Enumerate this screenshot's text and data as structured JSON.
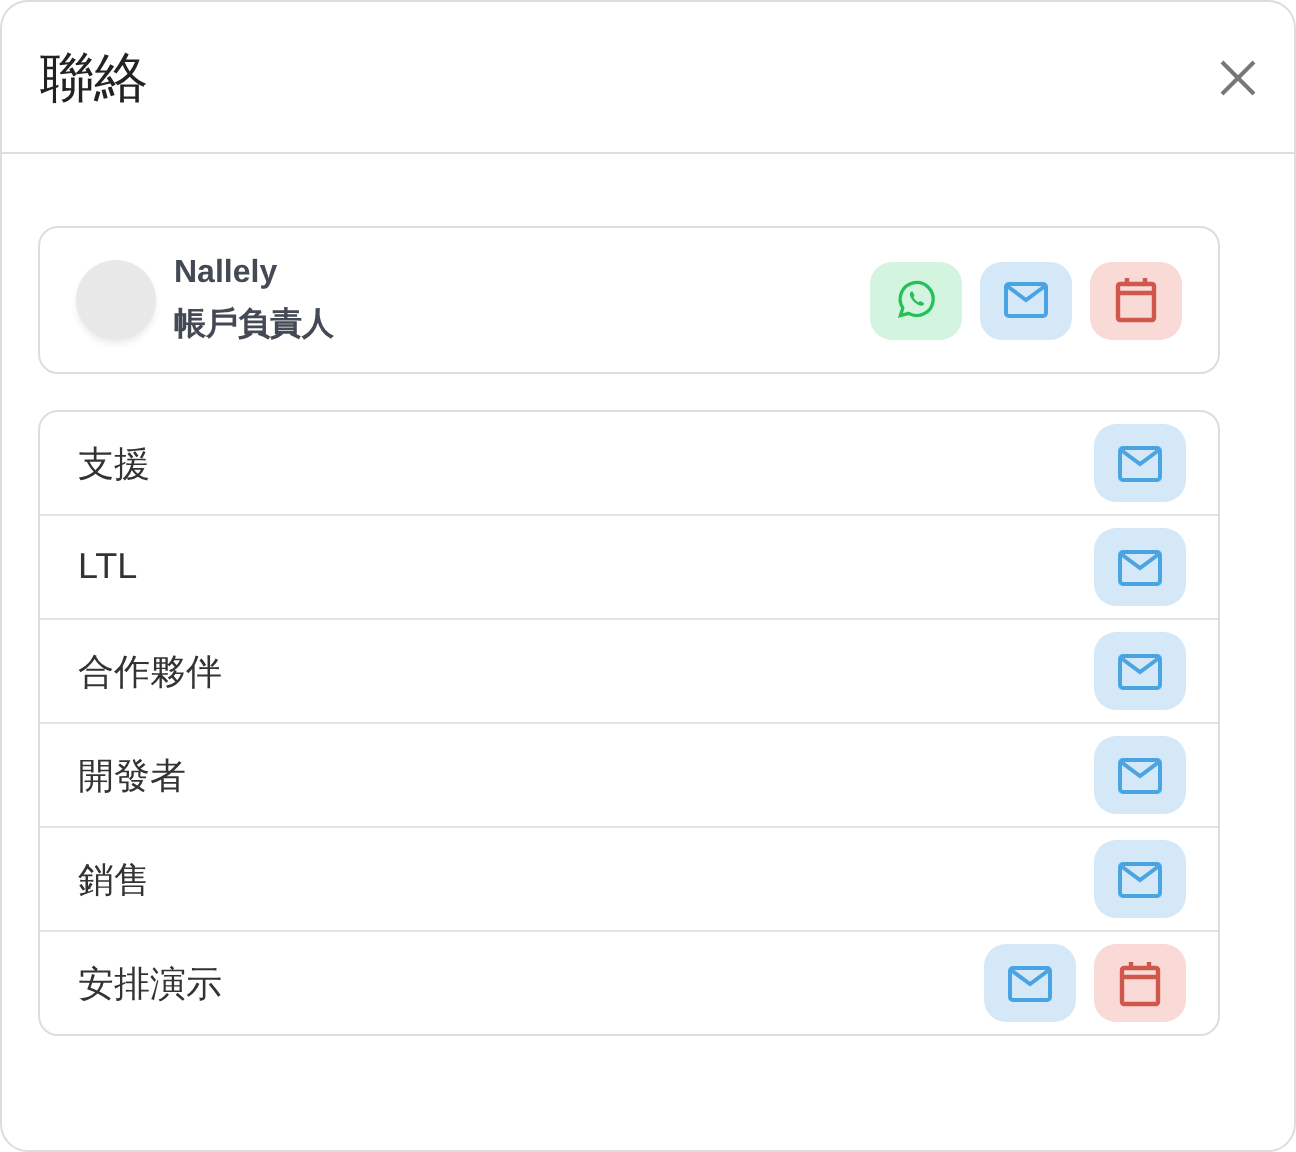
{
  "dialog": {
    "title": "聯絡"
  },
  "contact": {
    "name": "Nallely",
    "role": "帳戶負責人",
    "actions": [
      {
        "kind": "whatsapp"
      },
      {
        "kind": "email"
      },
      {
        "kind": "calendar"
      }
    ]
  },
  "departments": [
    {
      "label": "支援",
      "actions": [
        {
          "kind": "email"
        }
      ]
    },
    {
      "label": "LTL",
      "actions": [
        {
          "kind": "email"
        }
      ]
    },
    {
      "label": "合作夥伴",
      "actions": [
        {
          "kind": "email"
        }
      ]
    },
    {
      "label": "開發者",
      "actions": [
        {
          "kind": "email"
        }
      ]
    },
    {
      "label": "銷售",
      "actions": [
        {
          "kind": "email"
        }
      ]
    },
    {
      "label": "安排演示",
      "actions": [
        {
          "kind": "email"
        },
        {
          "kind": "calendar"
        }
      ]
    }
  ]
}
